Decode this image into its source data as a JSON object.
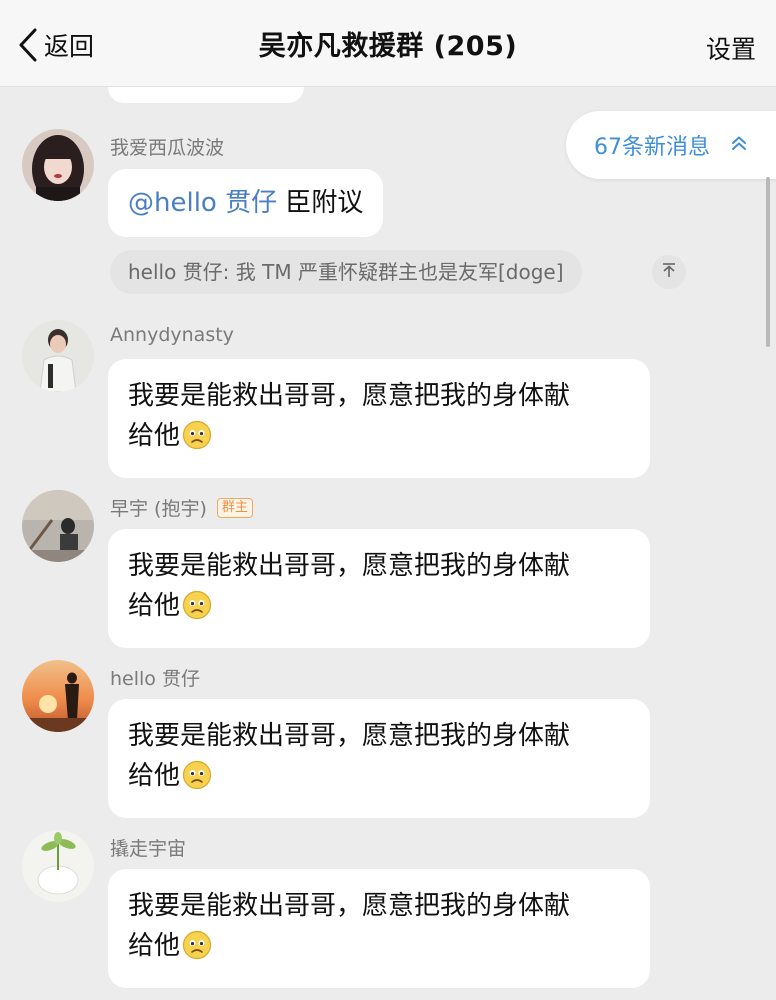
{
  "header": {
    "back_label": "返回",
    "title": "吴亦凡救援群 (205)",
    "settings_label": "设置"
  },
  "new_messages": {
    "label": "67条新消息"
  },
  "messages": [
    {
      "sender": "我爱西瓜波波",
      "mention": "@hello 贯仔",
      "text": " 臣附议",
      "quote": "hello 贯仔: 我 TM 严重怀疑群主也是友军[doge]"
    },
    {
      "sender": "Annydynasty",
      "text_line1": "我要是能救出哥哥，愿意把我的身体献",
      "text_line2": "给他"
    },
    {
      "sender": "早宇 (抱宇)",
      "badge": "群主",
      "text_line1": "我要是能救出哥哥，愿意把我的身体献",
      "text_line2": "给他"
    },
    {
      "sender": "hello 贯仔",
      "text_line1": "我要是能救出哥哥，愿意把我的身体献",
      "text_line2": "给他"
    },
    {
      "sender": "撬走宇宙",
      "text_line1": "我要是能救出哥哥，愿意把我的身体献",
      "text_line2": "给他"
    }
  ],
  "icons": {
    "back": "chevron-left-icon",
    "new_messages": "double-chevron-up-icon",
    "quote_jump": "jump-to-top-icon",
    "emoji": "worried-face-emoji"
  },
  "colors": {
    "background": "#ececec",
    "header": "#f7f7f7",
    "bubble": "#ffffff",
    "mention": "#4a7fc4",
    "new_messages": "#3f8fd7",
    "owner_badge": "#e8924a"
  }
}
